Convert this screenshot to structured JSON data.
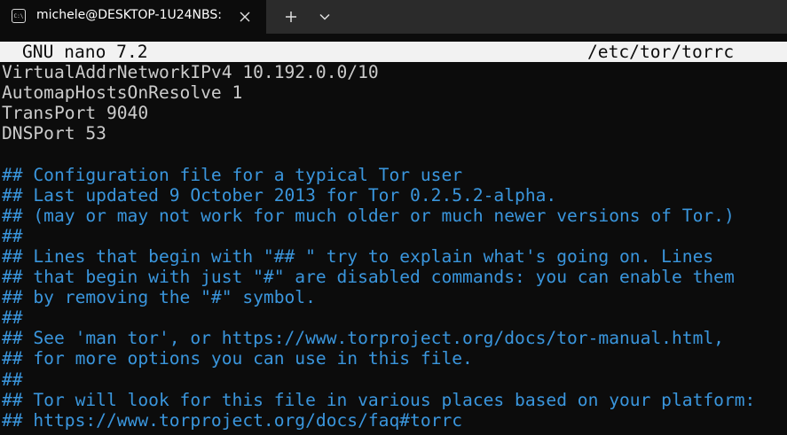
{
  "tab": {
    "title": "michele@DESKTOP-1U24NBS:",
    "icon": "terminal-icon",
    "close_icon": "close-icon"
  },
  "toolbar": {
    "new_tab_icon": "plus-icon",
    "dropdown_icon": "chevron-down-icon"
  },
  "nano": {
    "app": "GNU nano 7.2",
    "file_path": "/etc/tor/torrc"
  },
  "editor": {
    "lines": [
      "VirtualAddrNetworkIPv4 10.192.0.0/10",
      "AutomapHostsOnResolve 1",
      "TransPort 9040",
      "DNSPort 53",
      "",
      "## Configuration file for a typical Tor user",
      "## Last updated 9 October 2013 for Tor 0.2.5.2-alpha.",
      "## (may or may not work for much older or much newer versions of Tor.)",
      "##",
      "## Lines that begin with \"## \" try to explain what's going on. Lines",
      "## that begin with just \"#\" are disabled commands: you can enable them",
      "## by removing the \"#\" symbol.",
      "##",
      "## See 'man tor', or https://www.torproject.org/docs/tor-manual.html,",
      "## for more options you can use in this file.",
      "##",
      "## Tor will look for this file in various places based on your platform:",
      "## https://www.torproject.org/docs/faq#torrc"
    ]
  },
  "colors": {
    "background": "#0c0c0c",
    "text": "#cccccc",
    "comment": "#3a96dd",
    "header_bg": "#f2f2f2",
    "tabbar_bg": "#2b2b2b"
  }
}
